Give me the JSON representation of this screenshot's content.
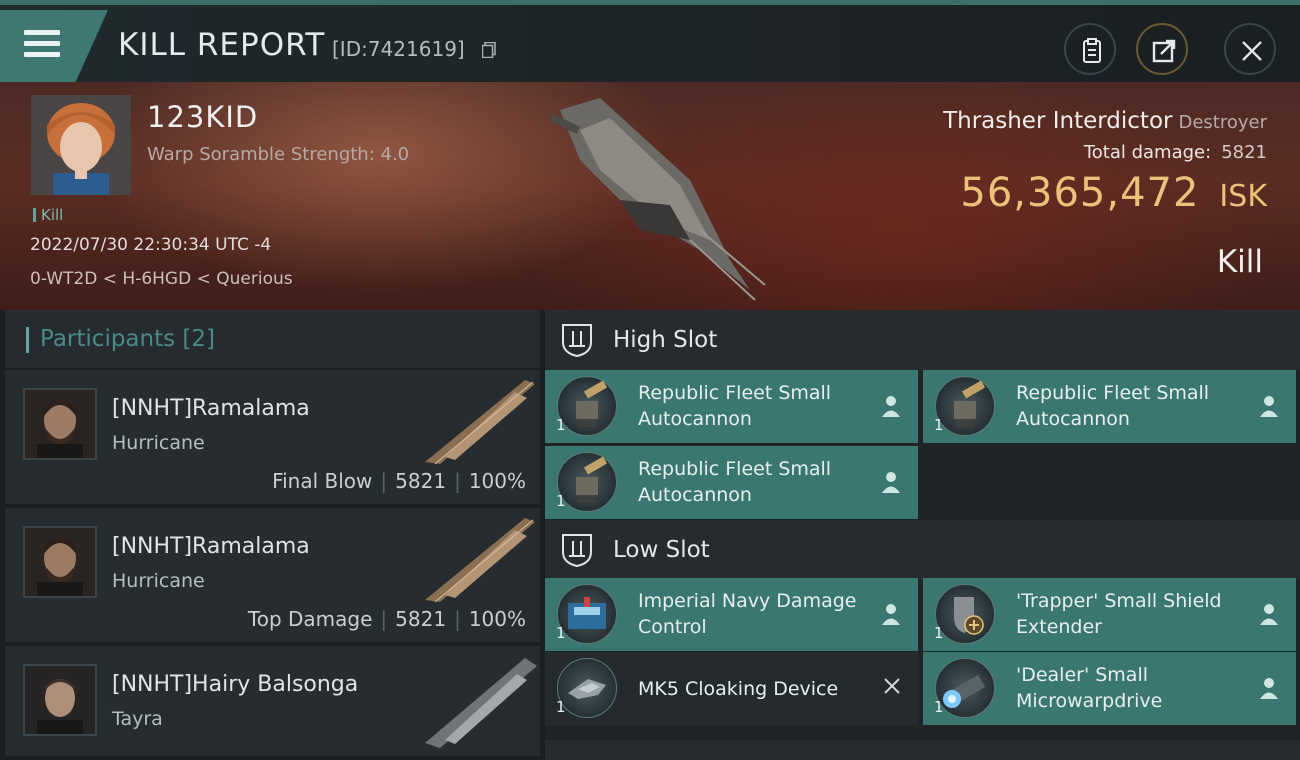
{
  "header": {
    "title": "KILL REPORT",
    "report_id": "[ID:7421619]"
  },
  "victim": {
    "name": "123KID",
    "scramble": "Warp Soramble Strength: 4.0",
    "tag": "Kill",
    "datetime": "2022/07/30 22:30:34 UTC -4",
    "location": "0-WT2D < H-6HGD < Querious",
    "ship_name": "Thrasher Interdictor",
    "ship_class": "Destroyer",
    "total_damage_label": "Total damage:",
    "total_damage": "5821",
    "isk_value": "56,365,472",
    "isk_unit": "ISK",
    "result": "Kill"
  },
  "participants": {
    "title": "Participants",
    "count": "[2]",
    "list": [
      {
        "name": "[NNHT]Ramalama",
        "ship": "Hurricane",
        "role": "Final Blow",
        "damage": "5821",
        "percent": "100%"
      },
      {
        "name": "[NNHT]Ramalama",
        "ship": "Hurricane",
        "role": "Top Damage",
        "damage": "5821",
        "percent": "100%"
      },
      {
        "name": "[NNHT]Hairy Balsonga",
        "ship": "Tayra"
      }
    ]
  },
  "fitting": {
    "high_slot": {
      "title": "High Slot",
      "modules": [
        {
          "qty": "1",
          "name": "Republic Fleet Small Autocannon",
          "status": "dropped"
        },
        {
          "qty": "1",
          "name": "Republic Fleet Small Autocannon",
          "status": "dropped"
        },
        {
          "qty": "1",
          "name": "Republic Fleet Small Autocannon",
          "status": "dropped"
        }
      ]
    },
    "low_slot": {
      "title": "Low Slot",
      "modules": [
        {
          "qty": "1",
          "name": "Imperial Navy Damage Control",
          "status": "dropped"
        },
        {
          "qty": "1",
          "name": "'Trapper' Small Shield Extender",
          "status": "dropped"
        },
        {
          "qty": "1",
          "name": "MK5 Cloaking Device",
          "status": "destroyed"
        },
        {
          "qty": "1",
          "name": "'Dealer' Small Microwarpdrive",
          "status": "dropped"
        }
      ]
    }
  },
  "colors": {
    "accent_teal": "#3a7771",
    "isk_gold": "#ecc27a",
    "banner_red": "#5a2c22"
  },
  "icons": [
    "menu-icon",
    "copy-icon",
    "clipboard-icon",
    "share-icon",
    "close-icon",
    "slot-icon",
    "person-icon",
    "x-icon"
  ]
}
